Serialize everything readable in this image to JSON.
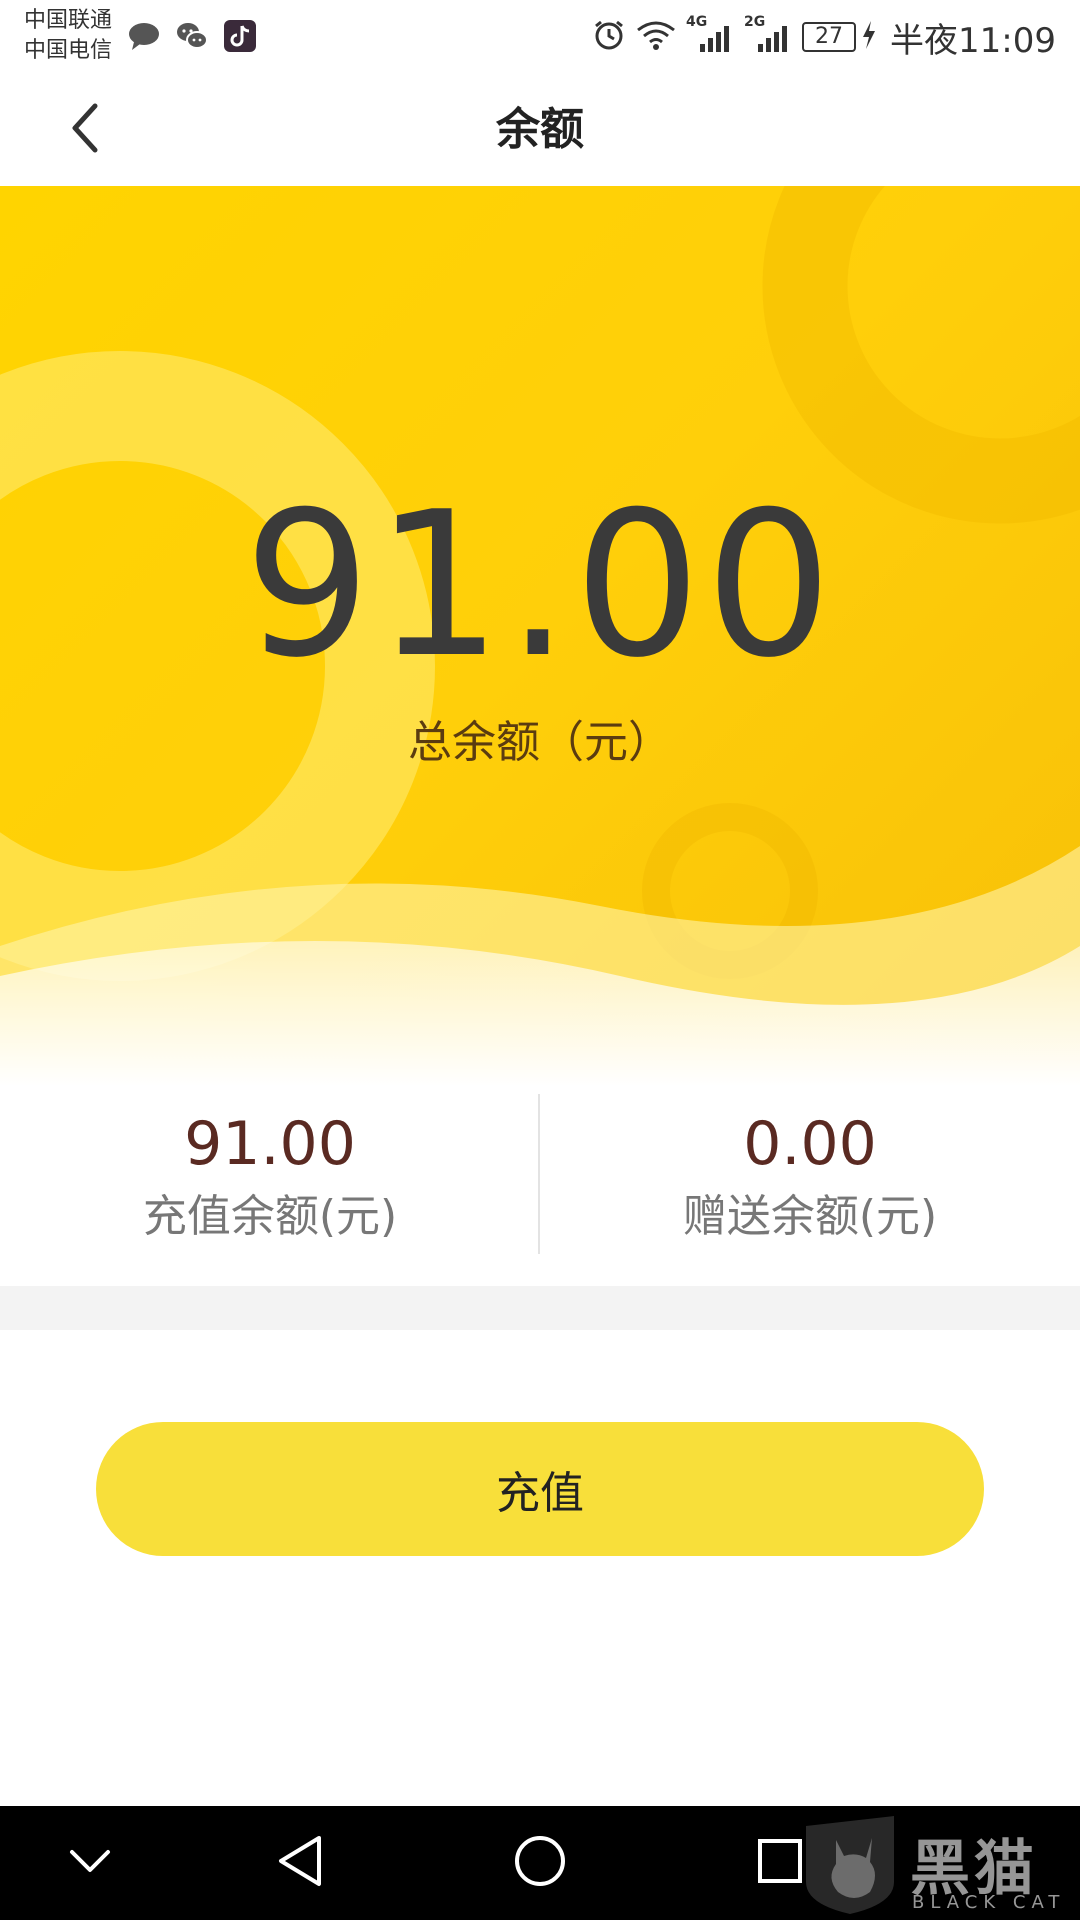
{
  "status_bar": {
    "carrier1": "中国联通",
    "carrier2": "中国电信",
    "left_icons": [
      "message-icon",
      "wechat-icon",
      "tiktok-icon"
    ],
    "right_icons": [
      "alarm-icon",
      "wifi-icon",
      "signal-4g-icon",
      "signal-2g-icon"
    ],
    "net1": "4G",
    "net2": "2G",
    "battery": "27",
    "time": "半夜11:09"
  },
  "header": {
    "title": "余额",
    "back_icon": "chevron-left-icon"
  },
  "hero": {
    "total_amount": "91.00",
    "total_label": "总余额（元）",
    "colors": {
      "yellow": "#ffd400",
      "text": "#3a3a3a",
      "label": "#5b3c10"
    }
  },
  "balances": {
    "recharge": {
      "value": "91.00",
      "label": "充值余额(元)"
    },
    "bonus": {
      "value": "0.00",
      "label": "赠送余额(元)"
    }
  },
  "action": {
    "recharge_button": "充值",
    "button_color": "#f8df3a"
  },
  "nav": {
    "icons": [
      "chevron-down-icon",
      "back-triangle-icon",
      "home-circle-icon",
      "recents-square-icon"
    ]
  },
  "watermark": {
    "text": "黑猫",
    "subtext": "BLACK CAT"
  }
}
